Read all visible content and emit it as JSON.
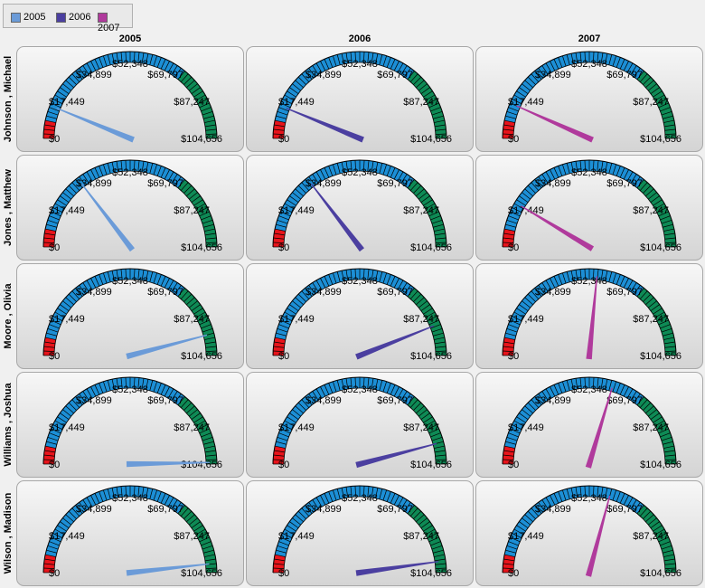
{
  "chart_data": {
    "type": "gauge",
    "legend": {
      "placement": "top-left",
      "items": [
        {
          "label": "2005",
          "color": "#6b9bd8"
        },
        {
          "label": "2006",
          "color": "#4b3fa0"
        },
        {
          "label": "2007",
          "color": "#b03a9c"
        }
      ]
    },
    "columns": [
      "2005",
      "2006",
      "2007"
    ],
    "rows": [
      "Johnson , Michael",
      "Jones , Matthew",
      "Moore , Olivia",
      "Williams , Joshua",
      "Wilson , Madison"
    ],
    "scale": {
      "min": 0,
      "max": 104656,
      "ticks": [
        {
          "value": 0,
          "label": "$0"
        },
        {
          "value": 17449,
          "label": "$17,449"
        },
        {
          "value": 34899,
          "label": "$34,899"
        },
        {
          "value": 52348,
          "label": "$52,348"
        },
        {
          "value": 69797,
          "label": "$69,797"
        },
        {
          "value": 87247,
          "label": "$87,247"
        },
        {
          "value": 104656,
          "label": "$104,656"
        }
      ],
      "bands": [
        {
          "from": 0,
          "to": 7000,
          "color": "#e8141b"
        },
        {
          "from": 7000,
          "to": 75000,
          "color": "#1c8fd6"
        },
        {
          "from": 75000,
          "to": 104656,
          "color": "#0e8a55"
        }
      ]
    },
    "values": [
      [
        13000,
        13000,
        14000
      ],
      [
        30500,
        30500,
        18000
      ],
      [
        96000,
        92000,
        55500
      ],
      [
        104000,
        96000,
        62000
      ],
      [
        101000,
        100000,
        61000
      ]
    ]
  }
}
